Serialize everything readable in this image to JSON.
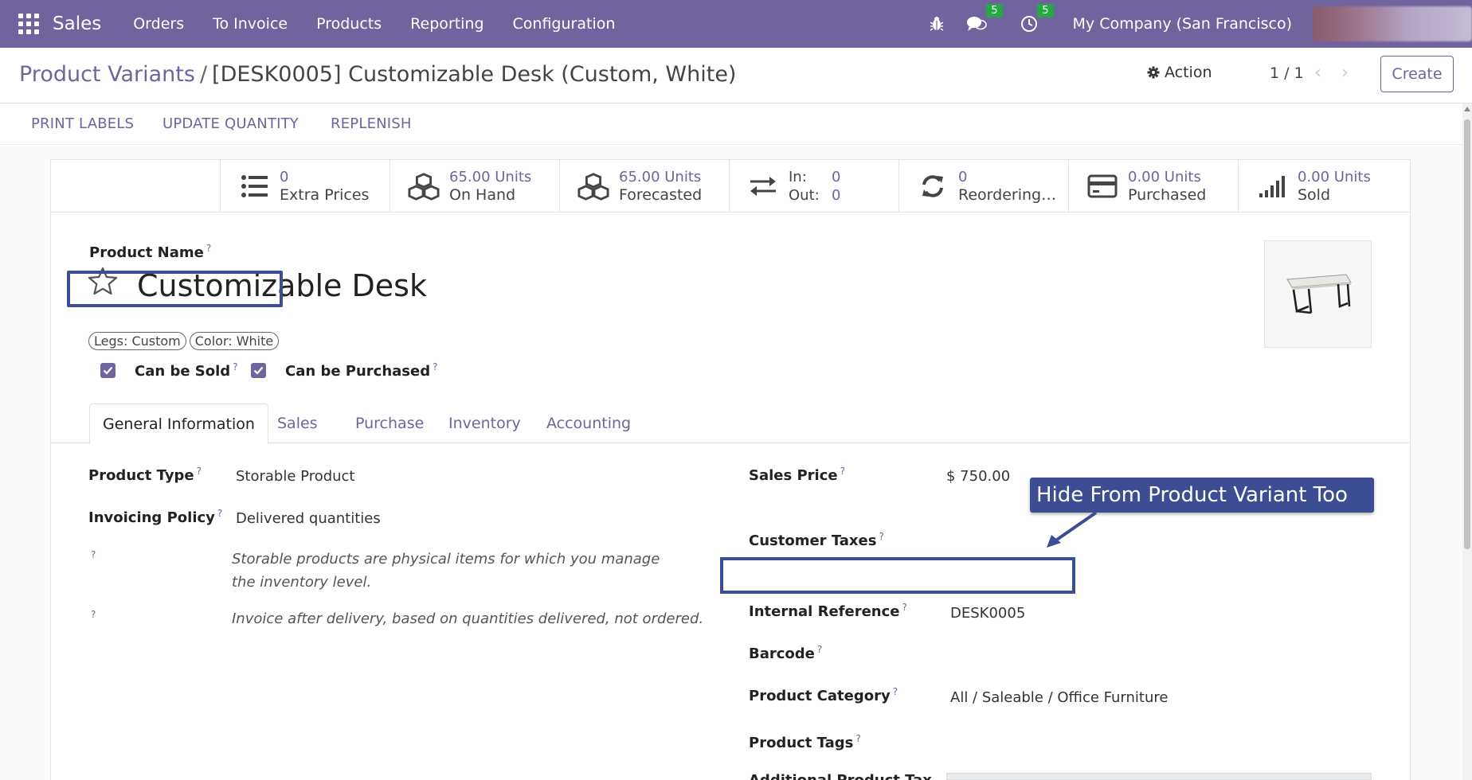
{
  "navbar": {
    "app_name": "Sales",
    "menu": [
      "Orders",
      "To Invoice",
      "Products",
      "Reporting",
      "Configuration"
    ],
    "messages_count": "5",
    "activities_count": "5",
    "company": "My Company (San Francisco)",
    "bg_color": "#71639e"
  },
  "control": {
    "breadcrumb_parent": "Product Variants",
    "breadcrumb_separator": "/",
    "breadcrumb_current": "[DESK0005] Customizable Desk (Custom, White)",
    "action_label": "Action",
    "pager": "1 / 1",
    "create_label": "Create"
  },
  "statusbar": {
    "buttons": [
      "PRINT LABELS",
      "UPDATE QUANTITY",
      "REPLENISH"
    ]
  },
  "smart_buttons": {
    "extra_prices": {
      "value": "0",
      "label": "Extra Prices",
      "icon": "list-icon"
    },
    "on_hand": {
      "value": "65.00 Units",
      "label": "On Hand",
      "icon": "cubes-icon"
    },
    "forecasted": {
      "value": "65.00 Units",
      "label": "Forecasted",
      "icon": "cubes-icon"
    },
    "in_out": {
      "in_label": "In:",
      "in_value": "0",
      "out_label": "Out:",
      "out_value": "0",
      "icon": "exchange-icon"
    },
    "reordering": {
      "value": "0",
      "label": "Reordering…",
      "icon": "refresh-icon"
    },
    "purchased": {
      "value": "0.00 Units",
      "label": "Purchased",
      "icon": "credit-card-icon"
    },
    "sold": {
      "value": "0.00 Units",
      "label": "Sold",
      "icon": "signal-icon"
    }
  },
  "product": {
    "name_label": "Product Name",
    "name": "Customizable Desk",
    "help_mark": "?",
    "attributes": [
      "Legs: Custom",
      "Color: White"
    ],
    "can_be_sold_label": "Can be Sold",
    "can_be_sold": true,
    "can_be_purchased_label": "Can be Purchased",
    "can_be_purchased": true
  },
  "tabs": [
    "General Information",
    "Sales",
    "Purchase",
    "Inventory",
    "Accounting"
  ],
  "general": {
    "product_type_label": "Product Type",
    "product_type": "Storable Product",
    "invoicing_policy_label": "Invoicing Policy",
    "invoicing_policy": "Delivered quantities",
    "help_storable": "Storable products are physical items for which you manage the inventory level.",
    "help_invoice": "Invoice after delivery, based on quantities delivered, not ordered.",
    "sales_price_label": "Sales Price",
    "sales_price": "$ 750.00",
    "customer_taxes_label": "Customer Taxes",
    "internal_reference_label": "Internal Reference",
    "internal_reference": "DESK0005",
    "barcode_label": "Barcode",
    "product_category_label": "Product Category",
    "product_category": "All / Saleable / Office Furniture",
    "product_tags_label": "Product Tags",
    "additional_tax_label": "Additional Product Tax"
  },
  "annotation": {
    "callout_text": "Hide From Product Variant Too",
    "color": "#3c4d93"
  }
}
